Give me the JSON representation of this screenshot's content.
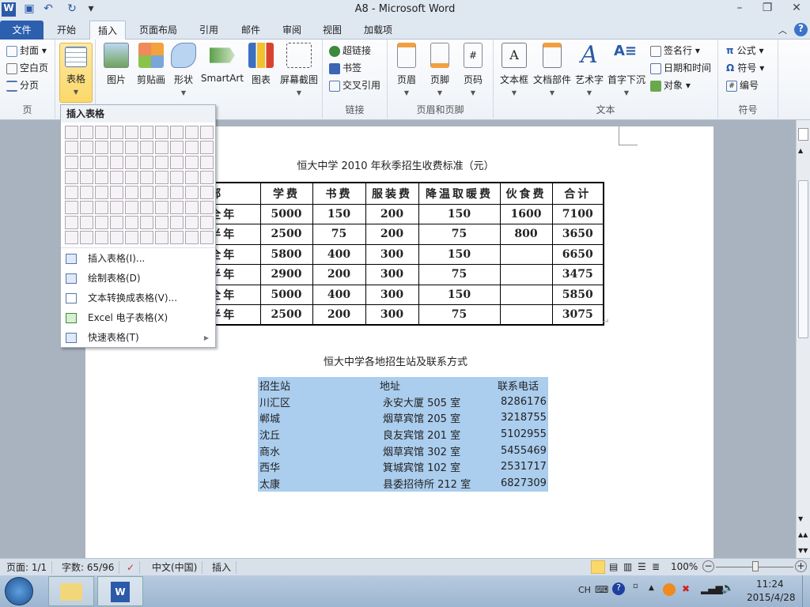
{
  "window": {
    "title": "A8  -  Microsoft Word",
    "app_icon": "W"
  },
  "tabs": [
    "文件",
    "开始",
    "插入",
    "页面布局",
    "引用",
    "邮件",
    "审阅",
    "视图",
    "加载项"
  ],
  "ribbon": {
    "groups": {
      "page": "页",
      "links": "链接",
      "header_footer": "页眉和页脚",
      "text": "文本",
      "symbols": "符号"
    },
    "page_items": [
      "封面",
      "空白页",
      "分页"
    ],
    "table": "表格",
    "illustrations": [
      "图片",
      "剪贴画",
      "形状",
      "SmartArt",
      "图表",
      "屏幕截图"
    ],
    "links": [
      "超链接",
      "书签",
      "交叉引用"
    ],
    "header_footer": [
      "页眉",
      "页脚",
      "页码"
    ],
    "text_big": [
      "文本框",
      "文档部件",
      "艺术字",
      "首字下沉"
    ],
    "text_small": [
      "签名行",
      "日期和时间",
      "对象"
    ],
    "symbols": [
      "公式",
      "符号",
      "编号"
    ]
  },
  "dropdown": {
    "header": "插入表格",
    "items": [
      "插入表格(I)...",
      "绘制表格(D)",
      "文本转换成表格(V)...",
      "Excel 电子表格(X)",
      "快速表格(T)"
    ]
  },
  "doc": {
    "title1": "恒大中学 2010 年秋季招生收费标准（元）",
    "table1": {
      "headers": [
        "学部",
        "学费",
        "书费",
        "服装费",
        "降温取暖费",
        "伙食费",
        "合计"
      ],
      "rows": [
        [
          "小学全年",
          "5000",
          "150",
          "200",
          "150",
          "1600",
          "7100"
        ],
        [
          "小学半年",
          "2500",
          "75",
          "200",
          "75",
          "800",
          "3650"
        ],
        [
          "初中全年",
          "5800",
          "400",
          "300",
          "150",
          "",
          "6650"
        ],
        [
          "初中半年",
          "2900",
          "200",
          "300",
          "75",
          "",
          "3475"
        ],
        [
          "高中全年",
          "5000",
          "400",
          "300",
          "150",
          "",
          "5850"
        ],
        [
          "高中半年",
          "2500",
          "200",
          "300",
          "75",
          "",
          "3075"
        ]
      ]
    },
    "title2": "恒大中学各地招生站及联系方式",
    "table2": {
      "headers": [
        "招生站",
        "地址",
        "联系电话"
      ],
      "rows": [
        [
          "川汇区",
          "永安大厦 505 室",
          "8286176"
        ],
        [
          "郸城",
          "烟草宾馆 205 室",
          "3218755"
        ],
        [
          "沈丘",
          "良友宾馆 201 室",
          "5102955"
        ],
        [
          "商水",
          "烟草宾馆 302 室",
          "5455469"
        ],
        [
          "西华",
          "箕城宾馆 102 室",
          "2531717"
        ],
        [
          "太康",
          "县委招待所 212 室",
          "6827309"
        ]
      ]
    }
  },
  "status": {
    "page": "页面: 1/1",
    "words": "字数: 65/96",
    "lang": "中文(中国)",
    "mode": "插入",
    "zoom": "100%"
  },
  "taskbar": {
    "ime": "CH",
    "time": "11:24",
    "date": "2015/4/28"
  }
}
